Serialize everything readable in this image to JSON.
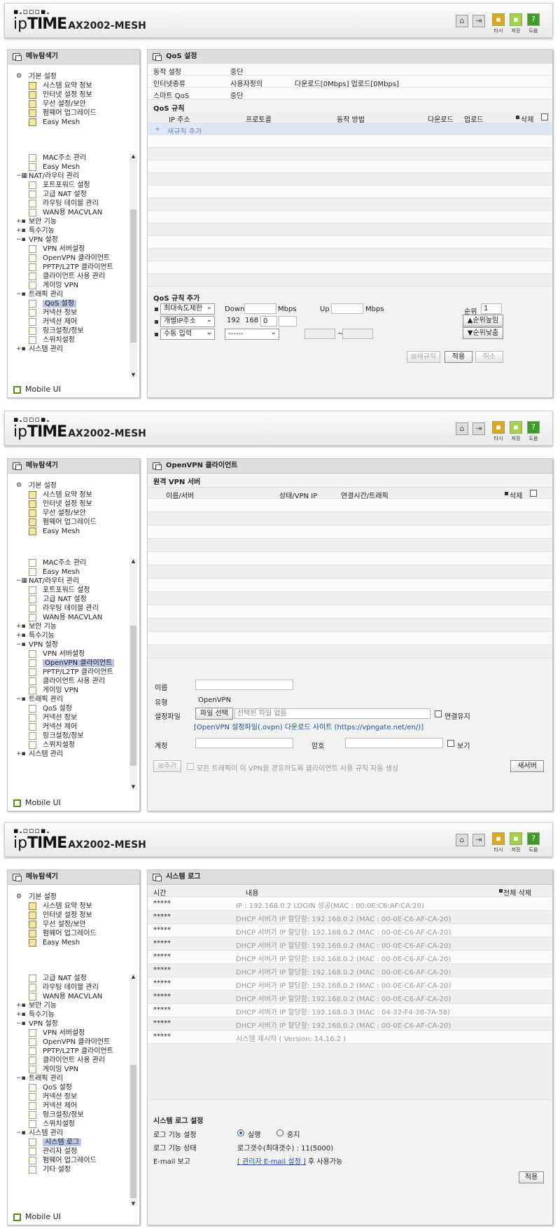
{
  "header": {
    "dots": "▪.▫▫▫▪.",
    "brand_ip": "ip",
    "brand_time": "TIME",
    "model": "AX2002-MESH",
    "home_label": "",
    "logout_label": "",
    "other_label": "타시",
    "save_label": "저장",
    "help_label": "도움"
  },
  "sidebar": {
    "title": "메뉴탐색기",
    "top_group": "기본 설정",
    "top_items": [
      "시스템 요약 정보",
      "인터넷 설정 정보",
      "무선 설정/보안",
      "펌웨어 업그레이드",
      "Easy Mesh"
    ],
    "mac": "MAC주소 관리",
    "easymesh": "Easy Mesh",
    "nat": "NAT/라우터 관리",
    "nat_items": [
      "포트포워드 설정",
      "고급 NAT 설정",
      "라우팅 테이블 관리",
      "WAN용 MACVLAN"
    ],
    "security": "보안 기능",
    "special": "특수기능",
    "vpn": "VPN 설정",
    "vpn_items": [
      "VPN 서버설정",
      "OpenVPN 클라이언트",
      "PPTP/L2TP 클라이언트",
      "클라이언트 사용 관리",
      "게이밍 VPN"
    ],
    "traffic": "트래픽 관리",
    "traffic_items": [
      "QoS 설정",
      "커넥션 정보",
      "커넥션 제어",
      "링크설정/정보",
      "스위치설정"
    ],
    "system": "시스템 관리",
    "system_items": [
      "시스템 로그",
      "관리자 설정",
      "펌웨어 업그레이드",
      "기타 설정"
    ],
    "mobile": "Mobile UI"
  },
  "qos": {
    "title": "QoS 설정",
    "op_label": "동작 설정",
    "op_value": "중단",
    "inet_label": "인터넷종류",
    "inet_value": "사용자정의",
    "inet_speed": "다운로드[0Mbps] 업로드[0Mbps]",
    "smart_label": "스마트 QoS",
    "smart_value": "중단",
    "rules_title": "QoS 규칙",
    "cols": [
      "IP 주소",
      "프로토콜",
      "동작 방법",
      "다운로드",
      "업로드",
      "삭제"
    ],
    "add_rule": "새규칙 추가",
    "add_title": "QoS 규칙 추가",
    "select1": "최대속도제한",
    "down": "Down",
    "mbps": "Mbps",
    "up": "Up",
    "priority": "순위",
    "priority_value": "1",
    "select2": "개별IP주소",
    "ip1": "192",
    "ip2": "168",
    "ip3": "0",
    "ip4": "",
    "btn_up": "▲순위높임",
    "select3": "수동 입력",
    "select4": "------",
    "tilde": "~",
    "btn_down": "▼순위낮춤",
    "btn_new": "새규칙",
    "btn_apply": "적용",
    "btn_cancel": "취소"
  },
  "ovpn": {
    "title": "OpenVPN 클라이언트",
    "section": "원격 VPN 서버",
    "cols": [
      "이름/서버",
      "상태/VPN IP",
      "연결시간/트래픽",
      "삭제"
    ],
    "name_label": "이름",
    "type_label": "유형",
    "type_value": "OpenVPN",
    "file_label": "설정파일",
    "file_btn": "파일 선택",
    "file_none": "선택된 파일 없음",
    "keep": "연결유지",
    "link": "[OpenVPN 설정파일(.ovpn) 다운로드 사이트 (https://vpngate.net/en/)]",
    "account_label": "계정",
    "password_label": "암호",
    "show": "보기",
    "add_btn": "추가",
    "auto_rule": "모든 트래픽이 이 VPN을 경유하도록 클라이언트 사용 규칙 자동 생성",
    "new_server": "새서버"
  },
  "syslog": {
    "title": "시스템 로그",
    "col_time": "시간",
    "col_content": "내용",
    "delete_all": "전체 삭제",
    "entries": [
      {
        "time": "*****",
        "text": "IP : 192.168.0.2 LOGIN 성공(MAC : 00:0E:C6:AF:CA:20)"
      },
      {
        "time": "*****",
        "text": "DHCP 서버가 IP 할당함: 192.168.0.2 (MAC : 00-0E-C6-AF-CA-20)"
      },
      {
        "time": "*****",
        "text": "DHCP 서버가 IP 할당함: 192.168.0.2 (MAC : 00-0E-C6-AF-CA-20)"
      },
      {
        "time": "*****",
        "text": "DHCP 서버가 IP 할당함: 192.168.0.2 (MAC : 00-0E-C6-AF-CA-20)"
      },
      {
        "time": "*****",
        "text": "DHCP 서버가 IP 할당함: 192.168.0.2 (MAC : 00-0E-C6-AF-CA-20)"
      },
      {
        "time": "*****",
        "text": "DHCP 서버가 IP 할당함: 192.168.0.2 (MAC : 00-0E-C6-AF-CA-20)"
      },
      {
        "time": "*****",
        "text": "DHCP 서버가 IP 할당함: 192.168.0.2 (MAC : 00-0E-C6-AF-CA-20)"
      },
      {
        "time": "*****",
        "text": "DHCP 서버가 IP 할당함: 192.168.0.2 (MAC : 00-0E-C6-AF-CA-20)"
      },
      {
        "time": "*****",
        "text": "DHCP 서버가 IP 할당함: 192.168.0.3 (MAC : 04-32-F4-38-7A-58)"
      },
      {
        "time": "*****",
        "text": "DHCP 서버가 IP 할당함: 192.168.0.2 (MAC : 00-0E-C6-AF-CA-20)"
      },
      {
        "time": "*****",
        "text": "시스템 재시작 ( Version: 14.16.2 )"
      }
    ],
    "settings_title": "시스템 로그 설정",
    "func_label": "로그 기능 설정",
    "run": "실행",
    "stop": "중지",
    "status_label": "로그 기능 상태",
    "status_value": "로그갯수(최대갯수) : 11(5000)",
    "email_label": "E-mail 보고",
    "email_link": "[ 관리자 E-mail 설정 ]",
    "email_suffix": " 후 사용가능",
    "apply": "적용"
  }
}
